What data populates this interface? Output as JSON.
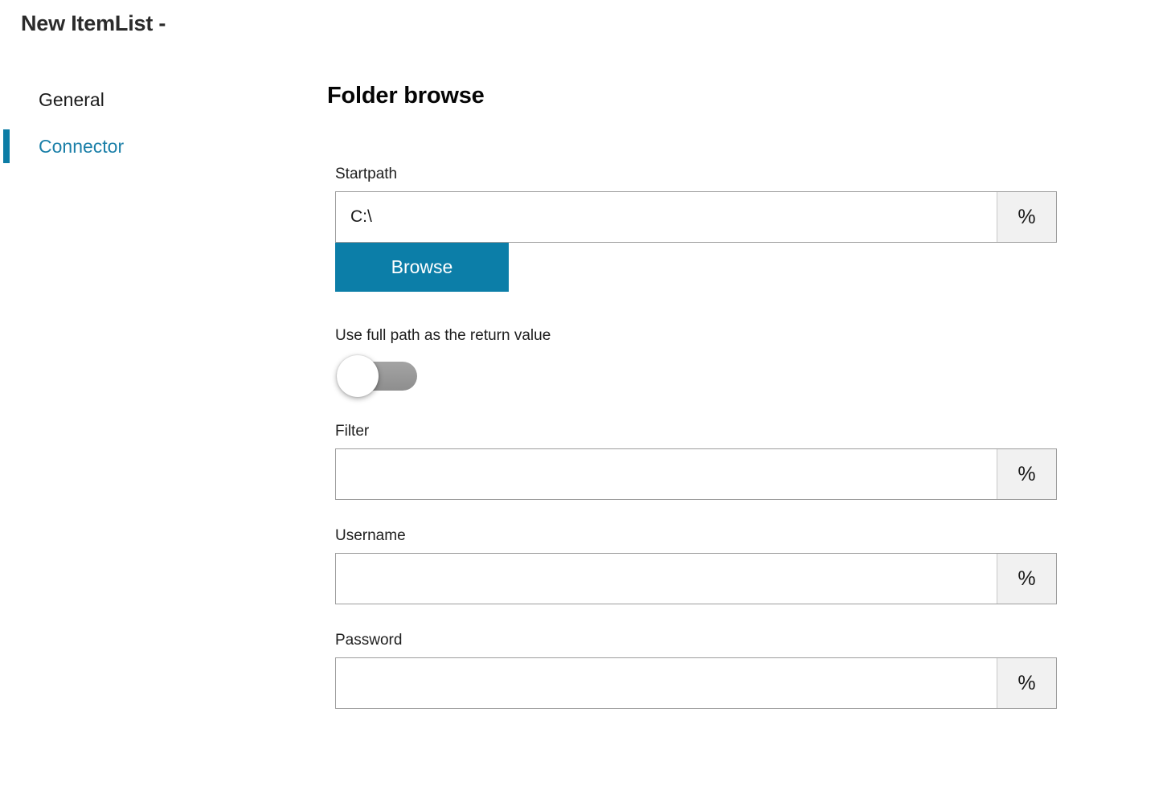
{
  "window": {
    "title": "New ItemList -"
  },
  "sidebar": {
    "items": [
      {
        "label": "General",
        "selected": false
      },
      {
        "label": "Connector",
        "selected": true
      }
    ]
  },
  "main": {
    "section_title": "Folder browse",
    "fields": {
      "startpath": {
        "label": "Startpath",
        "value": "C:\\",
        "placeholder": "",
        "suffix_button": "%"
      },
      "browse": {
        "label": "Browse"
      },
      "use_full_path": {
        "label": "Use full path as the return value",
        "state": "off"
      },
      "filter": {
        "label": "Filter",
        "value": "",
        "placeholder": "",
        "suffix_button": "%"
      },
      "username": {
        "label": "Username",
        "value": "",
        "placeholder": "",
        "suffix_button": "%"
      },
      "password": {
        "label": "Password",
        "value": "",
        "placeholder": "",
        "suffix_button": "%"
      }
    }
  },
  "colors": {
    "accent": "#0c7ea8",
    "selected_nav_text": "#1a7fa8",
    "suffix_bg": "#f1f1f1",
    "toggle_track_off": "#9a9a9a",
    "field_border": "#9d9d9d"
  }
}
